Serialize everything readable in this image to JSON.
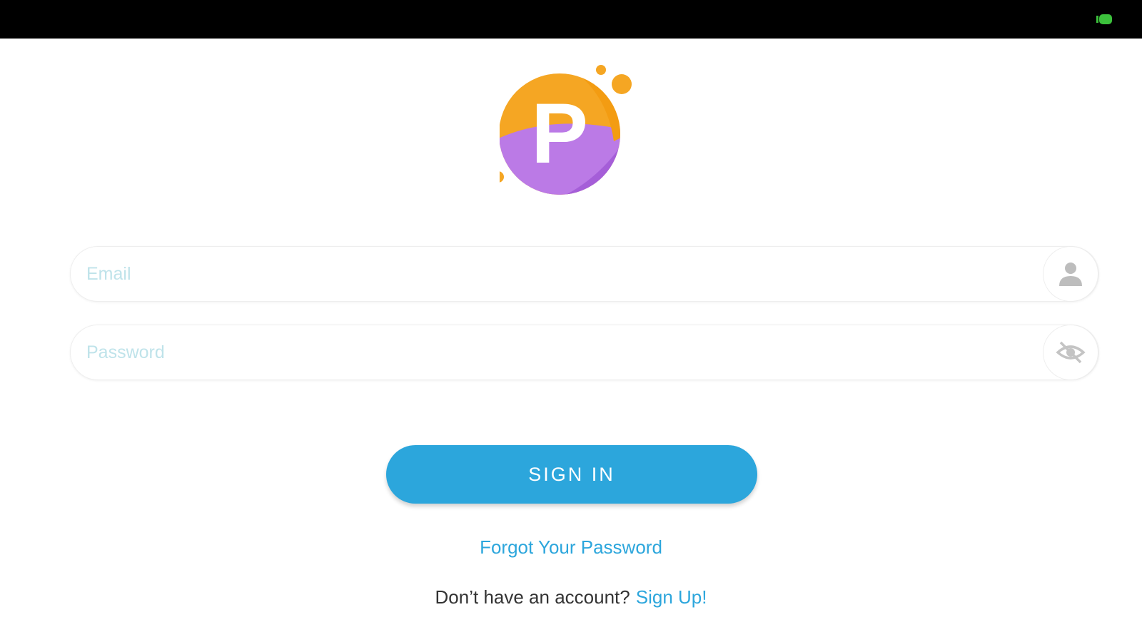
{
  "status_bar": {
    "battery_icon": "battery-icon",
    "battery_color": "#3cc13c"
  },
  "logo": {
    "letter": "P",
    "colors": {
      "orange": "#f5a623",
      "purple": "#b56ee0",
      "white": "#ffffff"
    }
  },
  "form": {
    "email": {
      "placeholder": "Email",
      "value": "",
      "icon": "person-icon"
    },
    "password": {
      "placeholder": "Password",
      "value": "",
      "icon": "eye-off-icon"
    },
    "sign_in_label": "SIGN IN",
    "forgot_password_label": "Forgot Your Password",
    "no_account_text": "Don’t have an account?",
    "sign_up_label": "Sign Up!"
  },
  "colors": {
    "accent": "#2ca6dc",
    "placeholder": "#bfe3ea",
    "text": "#333333",
    "status_bar": "#000000"
  }
}
